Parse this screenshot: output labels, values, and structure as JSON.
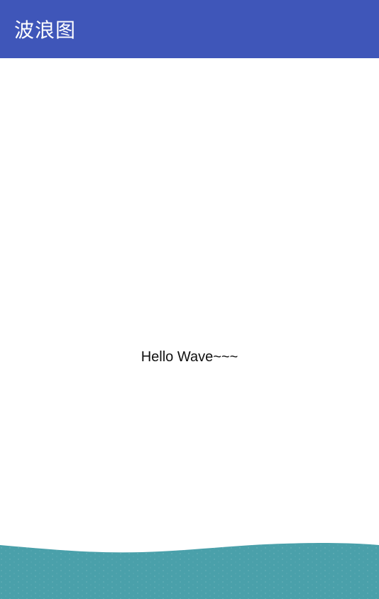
{
  "toolbar": {
    "title": "波浪图",
    "background": "#3f56b9"
  },
  "content": {
    "text": "Hello Wave~~~"
  },
  "wave": {
    "color": "#4aa0aa"
  }
}
